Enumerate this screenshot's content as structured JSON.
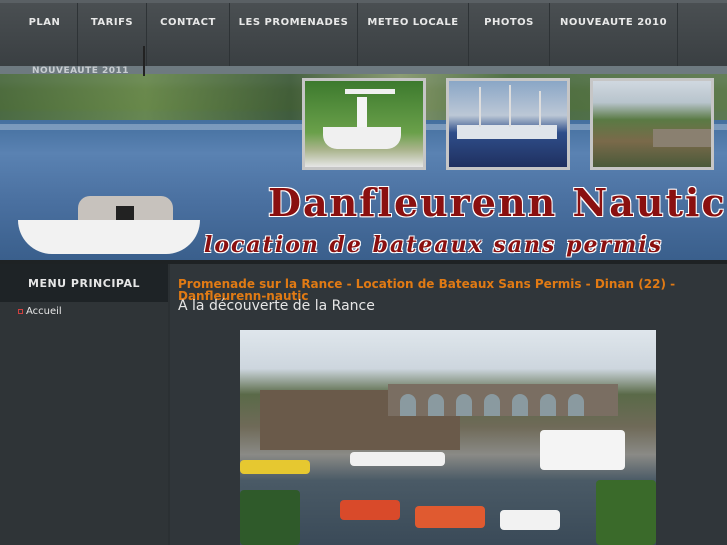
{
  "nav": {
    "items": [
      "PLAN",
      "TARIFS",
      "CONTACT",
      "LES PROMENADES",
      "METEO LOCALE",
      "PHOTOS",
      "NOUVEAUTE 2010"
    ],
    "dropdown_label": "NOUVEAUTE 2011"
  },
  "banner": {
    "title_line1": "Danfleurenn  Nautic",
    "title_line2": "location de bateaux sans permis"
  },
  "sidebar": {
    "heading": "MENU PRINCIPAL",
    "items": [
      {
        "label": "Accueil"
      }
    ]
  },
  "main": {
    "article_title": "Promenade sur la Rance - Location de Bateaux Sans Permis - Dinan (22) - Danfleurenn-nautic",
    "subtitle": "A la découverte de la Rance"
  }
}
